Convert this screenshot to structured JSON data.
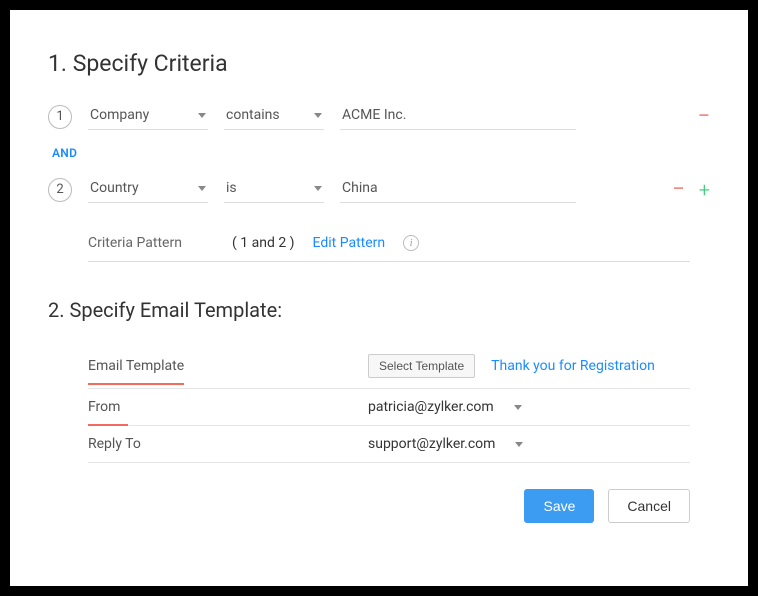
{
  "section1": {
    "title": "1. Specify Criteria",
    "and_label": "AND",
    "rows": [
      {
        "num": "1",
        "field": "Company",
        "op": "contains",
        "value": "ACME Inc."
      },
      {
        "num": "2",
        "field": "Country",
        "op": "is",
        "value": "China"
      }
    ],
    "pattern_label": "Criteria Pattern",
    "pattern_value": "( 1 and 2 )",
    "edit_pattern": "Edit Pattern"
  },
  "section2": {
    "title": "2. Specify Email Template:",
    "template_label": "Email Template",
    "select_template_btn": "Select Template",
    "template_name": "Thank you for Registration",
    "from_label": "From",
    "from_value": "patricia@zylker.com",
    "replyto_label": "Reply To",
    "replyto_value": "support@zylker.com"
  },
  "actions": {
    "save": "Save",
    "cancel": "Cancel"
  }
}
